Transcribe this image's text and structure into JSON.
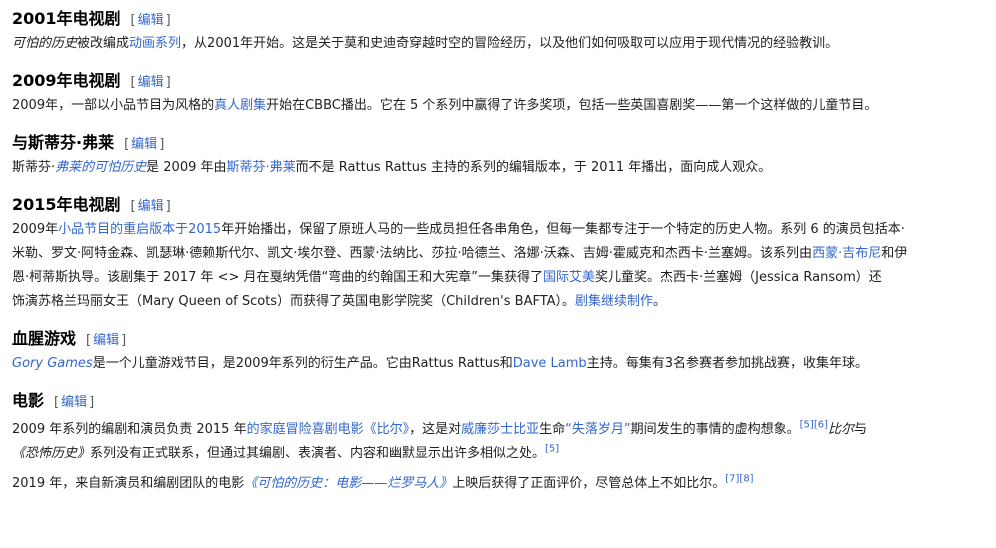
{
  "edit_label": "编辑",
  "sections": [
    {
      "title": "2001年电视剧",
      "p": [
        [
          "可怕的历史",
          "被改编成",
          "动画系列",
          "，从2001年开始。这是关于莫和史迪奇穿越时空的冒险经历，以及他们如何吸取可以应用于现代情况的经验教训。"
        ]
      ]
    },
    {
      "title": "2009年电视剧",
      "p": [
        [
          "2009年，一部以小品节目为风格的",
          "真人剧集",
          "开始在CBBC播出。它在 5 个系列中赢得了许多奖项，包括一些英国喜剧奖——第一个这样做的儿童节目。"
        ]
      ]
    },
    {
      "title": "与斯蒂芬·弗莱",
      "p": [
        [
          "斯蒂芬·",
          "弗莱的可怕历史",
          "是 2009 年由",
          "斯蒂芬·弗莱",
          "而不是 Rattus Rattus 主持的系列的编辑版本，于 2011 年播出，面向成人观众。"
        ]
      ]
    },
    {
      "title": "2015年电视剧",
      "p": [
        [
          "2009年",
          "小品节目的重启版本于2015",
          "年开始播出，保留了原班人马的一些成员担任各串角色，但每一集都专注于一个特定的历史人物。系列 6 的演员包括本·",
          "米勒、罗文·阿特金森、凯瑟琳·德赖斯代尔、凯文·埃尔登、西蒙·法纳比、莎拉·哈德兰、洛娜·沃森、吉姆·霍威克和杰西卡·兰塞姆。该系列由",
          "西蒙·吉布尼",
          "和伊",
          "恩·柯蒂斯执导。该剧集于 2017 年 <> 月在戛纳凭借“弯曲的约翰国王和大宪章”一集获得了",
          "国际艾美",
          "奖儿童奖。杰西卡·兰塞姆（Jessica Ransom）还",
          "饰演苏格兰玛丽女王（Mary Queen of Scots）而获得了英国电影学院奖（Children's BAFTA）。",
          "剧集继续制作",
          "。"
        ]
      ]
    },
    {
      "title": "血腥游戏",
      "p": [
        [
          "Gory Games",
          "是一个儿童游戏节目，是2009年系列的衍生产品。它由Rattus Rattus和",
          "Dave Lamb",
          "主持。每集有3名参赛者参加挑战赛，收集年球。"
        ]
      ]
    },
    {
      "title": "电影",
      "p": [
        [
          "2009 年系列的编剧和演员负责 2015 年",
          "的家庭冒险喜剧电影《比尔》",
          "，这是对",
          "威廉莎士比亚",
          "生命",
          "“失落岁月”",
          "期间发生的事情的虚构想象。",
          "[5]",
          "[6]",
          "比尔",
          "与",
          "《恐怖历史》",
          "系列没有正式联系，但通过其编剧、表演者、内容和幽默显示出许多相似之处。",
          "[5]"
        ],
        [
          "2019 年，来自新演员和编剧团队的电影",
          "《可怕的历史：电影——烂罗马人》",
          "上映后获得了正面评价，尽管总体上不如比尔。",
          "[7]",
          "[8]"
        ]
      ]
    }
  ]
}
